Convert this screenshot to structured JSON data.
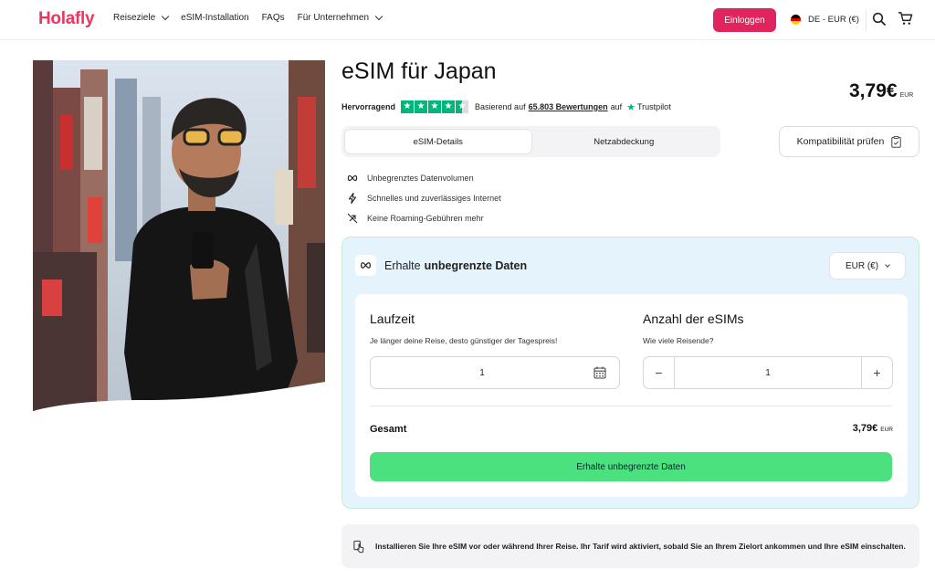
{
  "header": {
    "logo": "Holafly",
    "nav": [
      {
        "label": "Reiseziele",
        "dropdown": true
      },
      {
        "label": "eSIM-Installation",
        "dropdown": false
      },
      {
        "label": "FAQs",
        "dropdown": false
      },
      {
        "label": "Für Unternehmen",
        "dropdown": true
      }
    ],
    "login_label": "Einloggen",
    "locale_label": "DE - EUR (€)",
    "icons": [
      "search-icon",
      "cart-icon",
      "germany-flag-icon"
    ]
  },
  "product": {
    "title": "eSIM für Japan",
    "price": "3,79€",
    "price_unit": "EUR",
    "rating": {
      "label": "Hervorragend",
      "based_on": "Basierend auf",
      "count_text": "65.803 Bewertungen",
      "on": "auf",
      "provider": "Trustpilot",
      "stars": 4.5
    },
    "tabs": [
      {
        "label": "eSIM-Details",
        "active": true
      },
      {
        "label": "Netzabdeckung",
        "active": false
      }
    ],
    "compat_label": "Kompatibilität prüfen",
    "features": [
      {
        "icon": "infinity-icon",
        "label": "Unbegrenztes Datenvolumen"
      },
      {
        "icon": "lightning-icon",
        "label": "Schnelles und zuverlässiges Internet"
      },
      {
        "icon": "no-roaming-icon",
        "label": "Keine Roaming-Gebühren mehr"
      }
    ]
  },
  "plan": {
    "head_prefix": "Erhalte",
    "head_bold": "unbegrenzte Daten",
    "currency_label": "EUR (€)",
    "duration": {
      "title": "Laufzeit",
      "subtitle": "Je länger deine Reise, desto günstiger der Tagespreis!",
      "value": "1"
    },
    "esims": {
      "title": "Anzahl der eSIMs",
      "subtitle": "Wie viele Reisende?",
      "value": "1",
      "minus": "−",
      "plus": "+"
    },
    "total_label": "Gesamt",
    "total_value": "3,79€",
    "total_unit": "EUR",
    "cta_label": "Erhalte unbegrenzte Daten"
  },
  "notice": "Installieren Sie Ihre eSIM vor oder während Ihrer Reise. Ihr Tarif wird aktiviert, sobald Sie an Ihrem Zielort ankommen und Ihre eSIM einschalten.",
  "colors": {
    "brand": "#e0245e",
    "cta": "#4be17e",
    "plan_bg": "#e5f4fc",
    "trustpilot": "#00b67a"
  }
}
